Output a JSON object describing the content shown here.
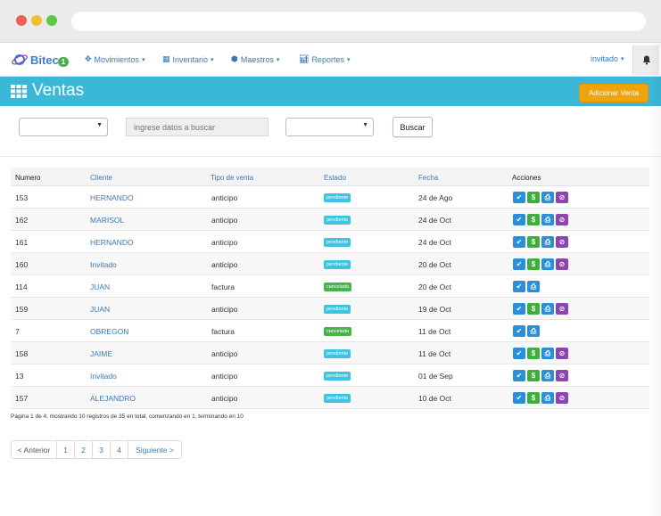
{
  "brand": {
    "name": "Bitec",
    "badge": "1"
  },
  "nav": {
    "movimientos": "Movimientos",
    "inventario": "Inventario",
    "maestros": "Maestros",
    "reportes": "Reportes",
    "user": "invitado"
  },
  "header": {
    "title": "Ventas",
    "add_button": "Adicionar Venta"
  },
  "filters": {
    "search_placeholder": "ingrese datos a buscar",
    "search_value": "",
    "select1_value": "",
    "select2_value": "",
    "search_button": "Buscar"
  },
  "table": {
    "headers": {
      "numero": "Numero",
      "cliente": "Cliente",
      "tipo": "Tipo de venta",
      "estado": "Estado",
      "fecha": "Fecha",
      "acciones": "Acciones"
    },
    "rows": [
      {
        "numero": "153",
        "cliente": "HERNANDO",
        "tipo": "anticipo",
        "estado": "pendiente",
        "fecha": "24 de Ago",
        "actions": [
          "check",
          "money",
          "print",
          "cancel"
        ]
      },
      {
        "numero": "162",
        "cliente": "MARISOL",
        "tipo": "anticipo",
        "estado": "pendiente",
        "fecha": "24 de Oct",
        "actions": [
          "check",
          "money",
          "print",
          "cancel"
        ]
      },
      {
        "numero": "161",
        "cliente": "HERNANDO",
        "tipo": "anticipo",
        "estado": "pendiente",
        "fecha": "24 de Oct",
        "actions": [
          "check",
          "money",
          "print",
          "cancel"
        ]
      },
      {
        "numero": "160",
        "cliente": "Invitado",
        "tipo": "anticipo",
        "estado": "pendiente",
        "fecha": "20 de Oct",
        "actions": [
          "check",
          "money",
          "print",
          "cancel"
        ]
      },
      {
        "numero": "114",
        "cliente": "JUAN",
        "tipo": "factura",
        "estado": "cancelada",
        "fecha": "20 de Oct",
        "actions": [
          "check",
          "print"
        ]
      },
      {
        "numero": "159",
        "cliente": "JUAN",
        "tipo": "anticipo",
        "estado": "pendiente",
        "fecha": "19 de Oct",
        "actions": [
          "check",
          "money",
          "print",
          "cancel"
        ]
      },
      {
        "numero": "7",
        "cliente": "OBREGON",
        "tipo": "factura",
        "estado": "cancelada",
        "fecha": "11 de Oct",
        "actions": [
          "check",
          "print"
        ]
      },
      {
        "numero": "158",
        "cliente": "JAIME",
        "tipo": "anticipo",
        "estado": "pendiente",
        "fecha": "11 de Oct",
        "actions": [
          "check",
          "money",
          "print",
          "cancel"
        ]
      },
      {
        "numero": "13",
        "cliente": "Invitado",
        "tipo": "anticipo",
        "estado": "pendiente",
        "fecha": "01 de Sep",
        "actions": [
          "check",
          "money",
          "print",
          "cancel"
        ]
      },
      {
        "numero": "157",
        "cliente": "ALEJANDRO",
        "tipo": "anticipo",
        "estado": "pendiente",
        "fecha": "10 de Oct",
        "actions": [
          "check",
          "money",
          "print",
          "cancel"
        ]
      }
    ]
  },
  "footer": {
    "info": "Página 1 de 4, mostrando 10 registros de 35 en total, comenzando en 1, terminando en 10"
  },
  "pagination": {
    "prev": "< Anterior",
    "pages": [
      "1",
      "2",
      "3",
      "4"
    ],
    "next": "Siguiente >"
  },
  "colors": {
    "header_band": "#3bb8d8",
    "add_button": "#f0a30a",
    "link": "#3a78b8",
    "pendiente": "#3ec3e0",
    "cancelada": "#46b34b"
  }
}
